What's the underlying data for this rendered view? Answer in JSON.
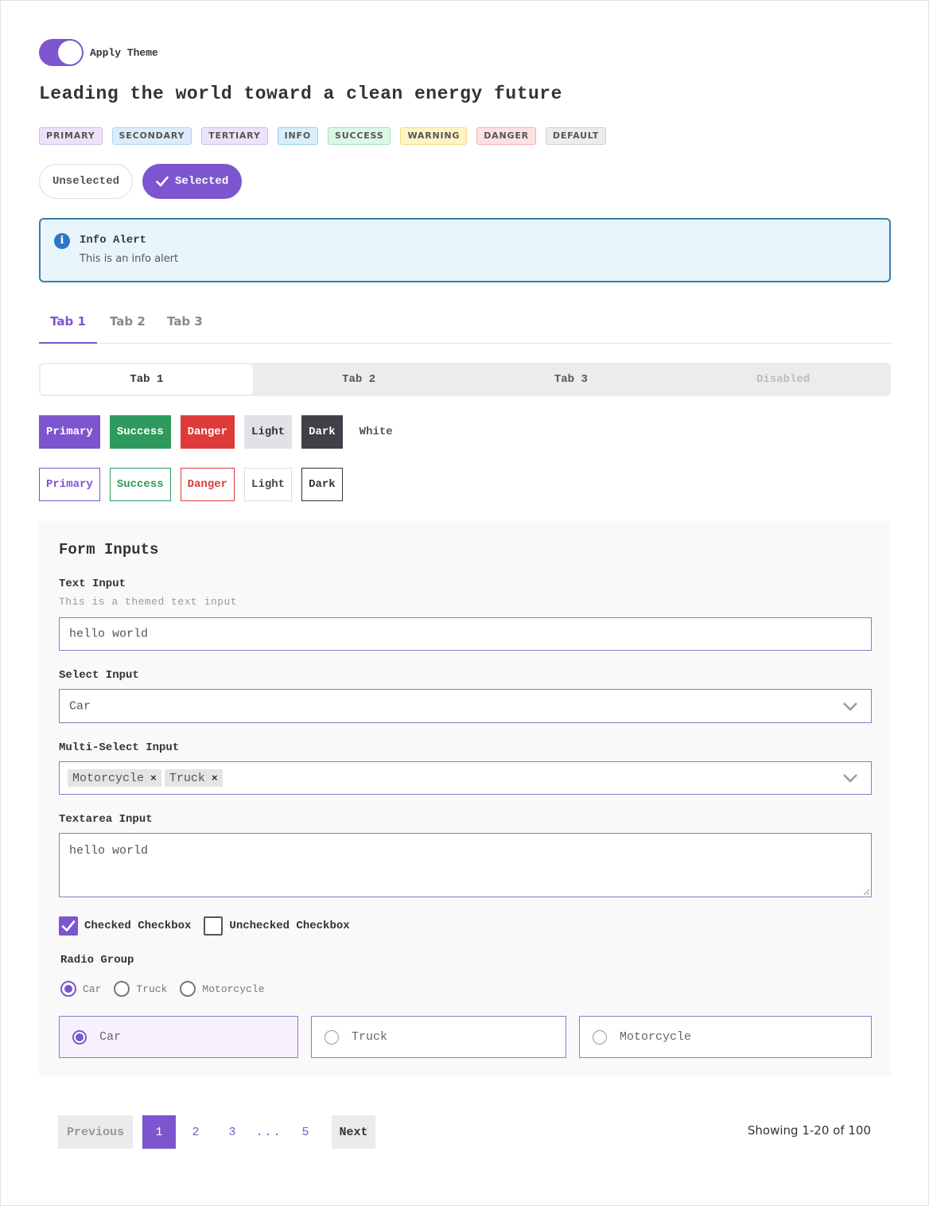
{
  "toggle": {
    "label": "Apply Theme",
    "on": true
  },
  "title": "Leading the world toward a clean energy future",
  "badges": [
    {
      "label": "PRIMARY",
      "bg": "#ece3fa",
      "border": "#cdb9ef",
      "color": "#555"
    },
    {
      "label": "SECONDARY",
      "bg": "#dcecfb",
      "border": "#b0d2f4",
      "color": "#555"
    },
    {
      "label": "TERTIARY",
      "bg": "#ece3fa",
      "border": "#cdb9ef",
      "color": "#555"
    },
    {
      "label": "INFO",
      "bg": "#d8eefb",
      "border": "#96cdeb",
      "color": "#555"
    },
    {
      "label": "SUCCESS",
      "bg": "#dcf7e5",
      "border": "#9fe1b6",
      "color": "#555"
    },
    {
      "label": "WARNING",
      "bg": "#fdf4c6",
      "border": "#f3dc78",
      "color": "#555"
    },
    {
      "label": "DANGER",
      "bg": "#fbe1e1",
      "border": "#f2b1b1",
      "color": "#555"
    },
    {
      "label": "DEFAULT",
      "bg": "#ececec",
      "border": "#cfcfcf",
      "color": "#555"
    }
  ],
  "chips": {
    "unselected": "Unselected",
    "selected": "Selected"
  },
  "alert": {
    "title": "Info Alert",
    "message": "This is an info alert"
  },
  "tabs_line": [
    "Tab 1",
    "Tab 2",
    "Tab 3"
  ],
  "tabs_segmented": [
    "Tab 1",
    "Tab 2",
    "Tab 3",
    "Disabled"
  ],
  "buttons_solid": [
    "Primary",
    "Success",
    "Danger",
    "Light",
    "Dark",
    "White"
  ],
  "buttons_outline": [
    "Primary",
    "Success",
    "Danger",
    "Light",
    "Dark"
  ],
  "form": {
    "title": "Form Inputs",
    "text_input": {
      "label": "Text Input",
      "hint": "This is a themed text input",
      "value": "hello world"
    },
    "select_input": {
      "label": "Select Input",
      "value": "Car"
    },
    "multi_select": {
      "label": "Multi-Select Input",
      "tags": [
        "Motorcycle",
        "Truck"
      ]
    },
    "textarea": {
      "label": "Textarea Input",
      "value": "hello world"
    },
    "checkboxes": [
      {
        "label": "Checked Checkbox",
        "checked": true
      },
      {
        "label": "Unchecked Checkbox",
        "checked": false
      }
    ],
    "radio_group": {
      "label": "Radio Group",
      "options": [
        "Car",
        "Truck",
        "Motorcycle"
      ],
      "selected": "Car"
    },
    "radio_cards": {
      "options": [
        "Car",
        "Truck",
        "Motorcycle"
      ],
      "selected": "Car"
    }
  },
  "pagination": {
    "previous": "Previous",
    "pages": [
      "1",
      "2",
      "3",
      "...",
      "5"
    ],
    "current": "1",
    "next": "Next",
    "summary": "Showing 1-20 of 100"
  },
  "colors": {
    "accent": "#7c55cf",
    "info_border": "#3a7fa6",
    "info_bg": "#e9f5fd"
  }
}
